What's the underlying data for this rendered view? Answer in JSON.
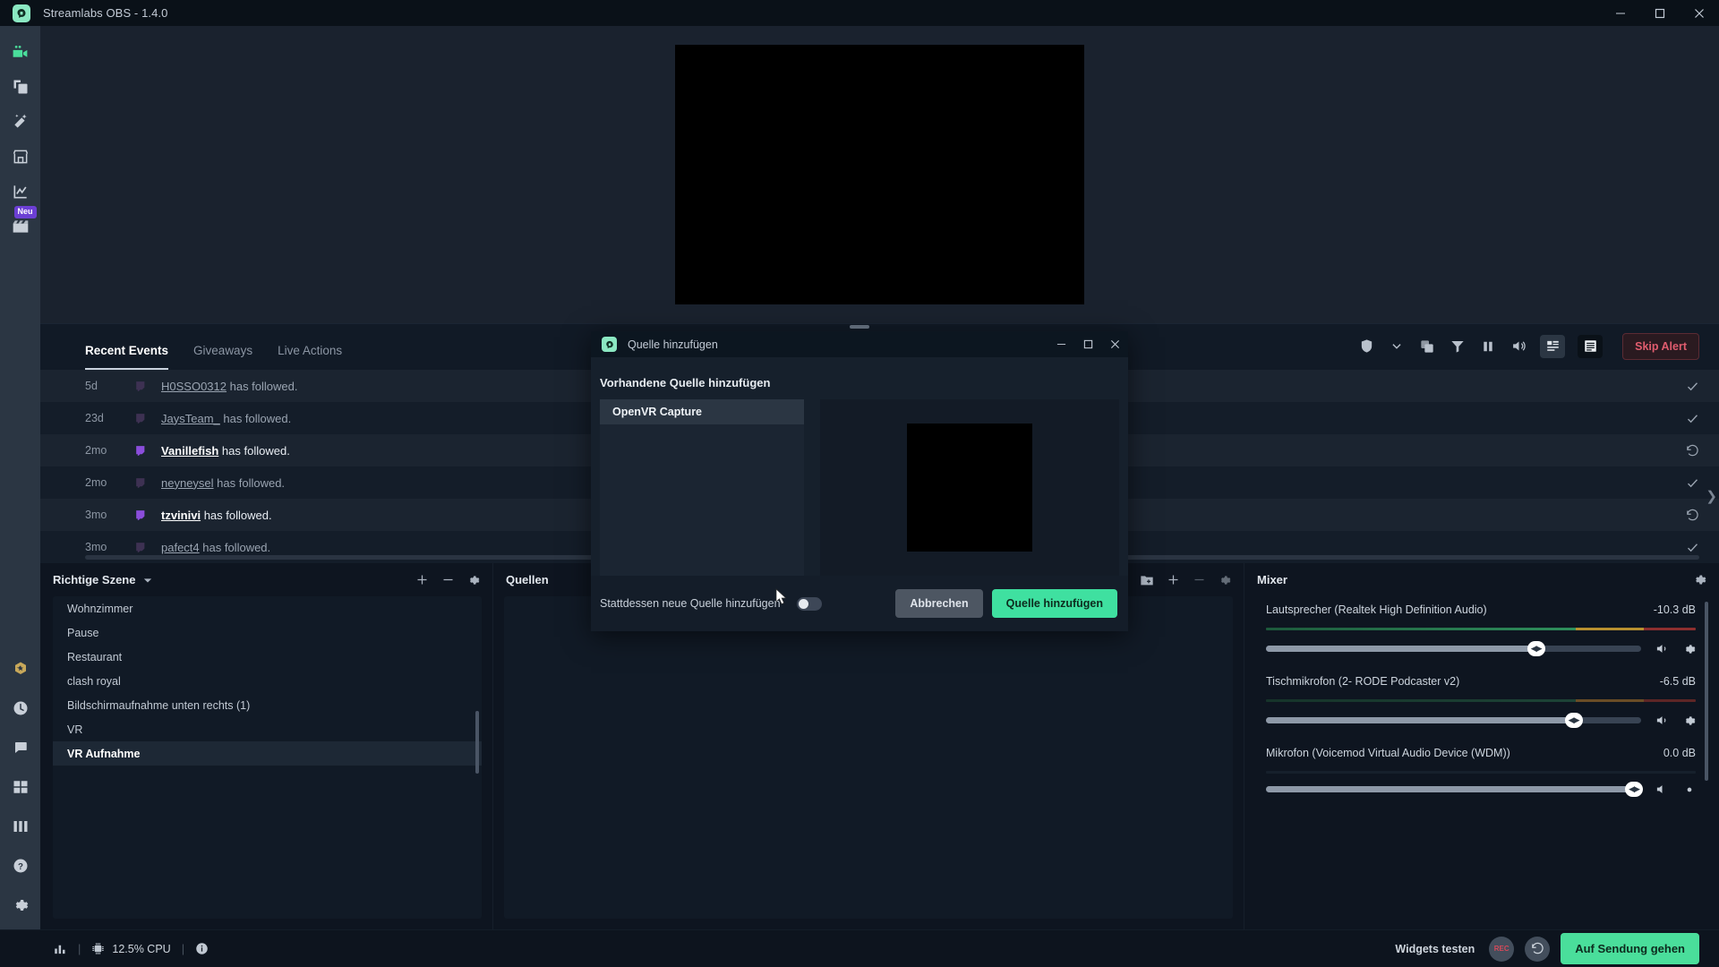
{
  "titlebar": {
    "title": "Streamlabs OBS - 1.4.0",
    "logo_icon": "streamlabs-logo-icon",
    "minimize_icon": "minimize-icon",
    "maximize_icon": "maximize-icon",
    "close_icon": "close-icon"
  },
  "navrail": {
    "top_items": [
      {
        "icon": "camera-icon",
        "name": "editor",
        "active": true
      },
      {
        "icon": "layers-icon",
        "name": "themes"
      },
      {
        "icon": "magic-wand-icon",
        "name": "alert-box"
      },
      {
        "icon": "store-icon",
        "name": "store"
      },
      {
        "icon": "chart-line-icon",
        "name": "dashboard"
      },
      {
        "icon": "clapperboard-icon",
        "name": "highlighter",
        "badge": "Neu"
      }
    ],
    "bottom_items": [
      {
        "icon": "prime-badge-icon",
        "name": "prime"
      },
      {
        "icon": "clock-icon",
        "name": "recent"
      },
      {
        "icon": "chat-bubble-icon",
        "name": "chat"
      },
      {
        "icon": "grid-icon",
        "name": "layout"
      },
      {
        "icon": "columns-icon",
        "name": "columns"
      },
      {
        "icon": "help-circle-icon",
        "name": "help"
      },
      {
        "icon": "gear-icon",
        "name": "settings"
      }
    ]
  },
  "events": {
    "tabs": [
      {
        "label": "Recent Events",
        "active": true
      },
      {
        "label": "Giveaways",
        "active": false
      },
      {
        "label": "Live Actions",
        "active": false
      }
    ],
    "tools": [
      {
        "icon": "shield-icon",
        "name": "moderation"
      },
      {
        "icon": "chevron-down-icon",
        "name": "moderation-dropdown"
      },
      {
        "icon": "copy-icon",
        "name": "duplicate"
      },
      {
        "icon": "filter-icon",
        "name": "filter"
      },
      {
        "icon": "pause-icon",
        "name": "pause-queue"
      },
      {
        "icon": "volume-icon",
        "name": "mute-alerts"
      }
    ],
    "view_grid_icon": "grid-view-icon",
    "view_list_icon": "list-view-icon",
    "skip_alert_label": "Skip Alert",
    "rows": [
      {
        "time": "5d",
        "platform": "twitch-icon",
        "user": "H0SSO0312",
        "text": " has followed.",
        "action": "check-icon",
        "highlight": false
      },
      {
        "time": "23d",
        "platform": "twitch-icon",
        "user": "JaysTeam_",
        "text": " has followed.",
        "action": "check-icon",
        "highlight": false
      },
      {
        "time": "2mo",
        "platform": "twitch-icon",
        "user": "Vanillefish",
        "text": " has followed.",
        "action": "replay-icon",
        "highlight": true
      },
      {
        "time": "2mo",
        "platform": "twitch-icon",
        "user": "neyneysel",
        "text": " has followed.",
        "action": "check-icon",
        "highlight": false
      },
      {
        "time": "3mo",
        "platform": "twitch-icon",
        "user": "tzvinivi",
        "text": " has followed.",
        "action": "replay-icon",
        "highlight": true
      },
      {
        "time": "3mo",
        "platform": "twitch-icon",
        "user": "pafect4",
        "text": " has followed.",
        "action": "check-icon",
        "highlight": false
      }
    ]
  },
  "scenes": {
    "title": "Richtige Szene",
    "caret_icon": "caret-down-icon",
    "add_icon": "plus-icon",
    "remove_icon": "minus-icon",
    "settings_icon": "gear-icon",
    "items": [
      {
        "label": "Wohnzimmer",
        "active": false
      },
      {
        "label": "Pause",
        "active": false
      },
      {
        "label": "Restaurant",
        "active": false
      },
      {
        "label": "clash royal",
        "active": false
      },
      {
        "label": "Bildschirmaufnahme unten rechts (1)",
        "active": false
      },
      {
        "label": "VR",
        "active": false
      },
      {
        "label": "VR Aufnahme",
        "active": true
      }
    ]
  },
  "sources": {
    "title": "Quellen",
    "tools": [
      {
        "icon": "microphone-slash-icon",
        "name": "audio-source"
      },
      {
        "icon": "folder-add-icon",
        "name": "add-folder"
      },
      {
        "icon": "plus-icon",
        "name": "add-source"
      },
      {
        "icon": "minus-icon",
        "name": "remove-source"
      },
      {
        "icon": "gear-icon",
        "name": "source-settings"
      }
    ]
  },
  "mixer": {
    "title": "Mixer",
    "settings_icon": "gear-icon",
    "channels": [
      {
        "name": "Lautsprecher (Realtek High Definition Audio)",
        "db": "-10.3 dB",
        "volume_pct": 72,
        "meter_green_pct": 72,
        "meter_yellow_pct": 20,
        "mute_icon": "volume-icon",
        "settings_icon": "gear-icon"
      },
      {
        "name": "Tischmikrofon (2- RODE Podcaster v2)",
        "db": "-6.5 dB",
        "volume_pct": 82,
        "meter_green_pct": 72,
        "meter_yellow_pct": 20,
        "mute_icon": "volume-icon",
        "settings_icon": "gear-icon"
      },
      {
        "name": "Mikrofon (Voicemod Virtual Audio Device (WDM))",
        "db": "0.0 dB",
        "volume_pct": 100,
        "meter_green_pct": 0,
        "meter_yellow_pct": 0,
        "mute_icon": "volume-icon",
        "settings_icon": "gear-icon"
      }
    ]
  },
  "statusbar": {
    "stats_icon": "bar-chart-icon",
    "cpu_icon": "cpu-icon",
    "cpu_text": "12.5% CPU",
    "info_icon": "info-icon",
    "separator": "|",
    "widgets_label": "Widgets testen",
    "rec_label": "REC",
    "replay_icon": "replay-buffer-icon",
    "go_live_label": "Auf Sendung gehen"
  },
  "dialog": {
    "title": "Quelle hinzufügen",
    "logo_icon": "streamlabs-logo-icon",
    "minimize_icon": "minimize-icon",
    "maximize_icon": "maximize-icon",
    "close_icon": "close-icon",
    "subtitle": "Vorhandene Quelle hinzufügen",
    "list": [
      {
        "label": "OpenVR Capture",
        "selected": true
      }
    ],
    "toggle_label": "Stattdessen neue Quelle hinzufügen",
    "toggle_on": false,
    "cancel_label": "Abbrechen",
    "confirm_label": "Quelle hinzufügen"
  },
  "colors": {
    "accent_green": "#3fe0a0",
    "danger_red": "#e05c6e",
    "panel_bg": "#111a26",
    "app_bg": "#0e1520",
    "nav_bg": "#2b3643"
  }
}
